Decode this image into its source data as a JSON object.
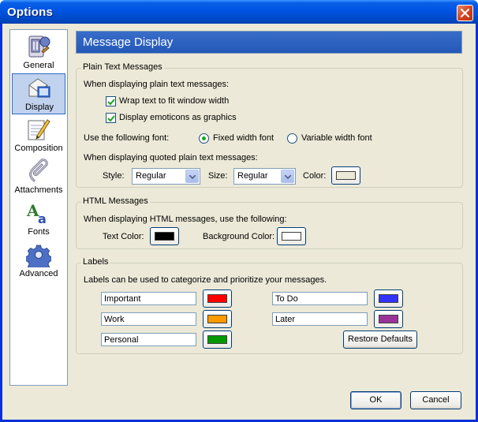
{
  "window": {
    "title": "Options"
  },
  "sidebar": {
    "items": [
      {
        "label": "General",
        "selected": false
      },
      {
        "label": "Display",
        "selected": true
      },
      {
        "label": "Composition",
        "selected": false
      },
      {
        "label": "Attachments",
        "selected": false
      },
      {
        "label": "Fonts",
        "selected": false
      },
      {
        "label": "Advanced",
        "selected": false
      }
    ]
  },
  "header": {
    "title": "Message Display"
  },
  "plain_text": {
    "group_title": "Plain Text Messages",
    "intro": "When displaying plain text messages:",
    "wrap_label": "Wrap text to fit window width",
    "wrap_checked": true,
    "emoticons_label": "Display emoticons as graphics",
    "emoticons_checked": true,
    "font_label": "Use the following font:",
    "fixed_font_label": "Fixed width font",
    "variable_font_label": "Variable width font",
    "font_choice": "fixed",
    "quoted_intro": "When displaying quoted plain text messages:",
    "style_label": "Style:",
    "style_value": "Regular",
    "size_label": "Size:",
    "size_value": "Regular",
    "color_label": "Color:",
    "quote_color": "#ece9d8"
  },
  "html_messages": {
    "group_title": "HTML Messages",
    "intro": "When displaying HTML messages, use the following:",
    "text_color_label": "Text Color:",
    "text_color": "#000000",
    "bg_color_label": "Background Color:",
    "bg_color": "#ffffff"
  },
  "labels": {
    "group_title": "Labels",
    "intro": "Labels can be used to categorize and prioritize your messages.",
    "items": [
      {
        "name": "Important",
        "color": "#ff0000"
      },
      {
        "name": "Work",
        "color": "#ff9900"
      },
      {
        "name": "Personal",
        "color": "#009900"
      },
      {
        "name": "To Do",
        "color": "#3333ff"
      },
      {
        "name": "Later",
        "color": "#993399"
      }
    ],
    "restore_label": "Restore Defaults"
  },
  "footer": {
    "ok_label": "OK",
    "cancel_label": "Cancel"
  },
  "icons": {
    "general": "general-settings-icon",
    "display": "display-icon",
    "composition": "composition-icon",
    "attachments": "paperclip-icon",
    "fonts": "fonts-icon",
    "advanced": "gear-icon"
  },
  "colors": {
    "titlebar": "#0054e3",
    "dialog_bg": "#ece9d8",
    "header_bg": "#2458b8",
    "selected_nav": "#c1d2ee"
  }
}
